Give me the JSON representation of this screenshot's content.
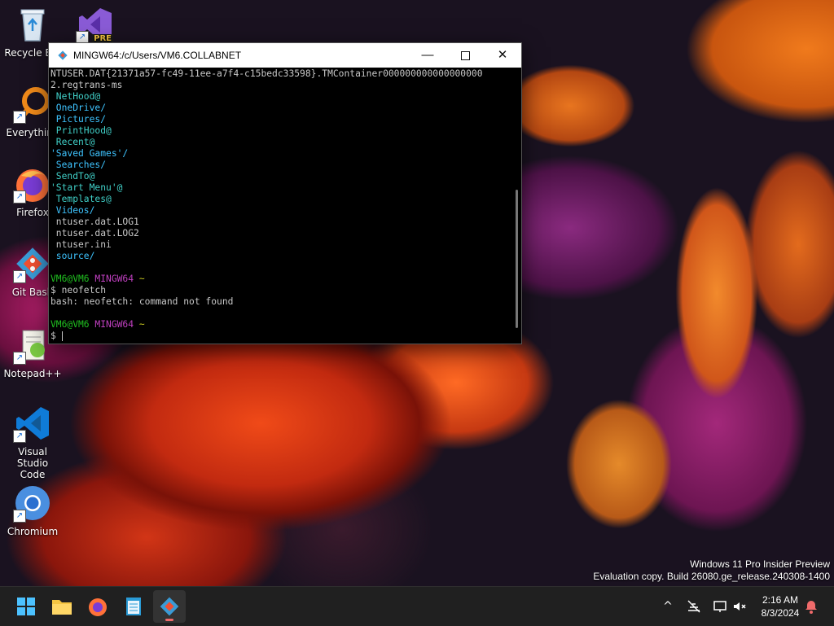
{
  "desktop": {
    "icons": [
      {
        "label": "Recycle Bin"
      },
      {
        "label": "",
        "badge": "PRE"
      },
      {
        "label": "Everything"
      },
      {
        "label": "Firefox"
      },
      {
        "label": "Git Bash"
      },
      {
        "label": "Notepad++"
      },
      {
        "label": "Visual Studio\nCode"
      },
      {
        "label": "Chromium"
      }
    ]
  },
  "terminal": {
    "title": "MINGW64:/c/Users/VM6.COLLABNET",
    "lines": [
      {
        "text": "NTUSER.DAT{21371a57-fc49-11ee-a7f4-c15bedc33598}.TMContainer000000000000000000",
        "cls": ""
      },
      {
        "text": "2.regtrans-ms",
        "cls": ""
      },
      {
        "text": " NetHood@",
        "cls": "c-link"
      },
      {
        "text": " OneDrive/",
        "cls": "c-dir"
      },
      {
        "text": " Pictures/",
        "cls": "c-dir"
      },
      {
        "text": " PrintHood@",
        "cls": "c-link"
      },
      {
        "text": " Recent@",
        "cls": "c-link"
      },
      {
        "text": "'Saved Games'/",
        "cls": "c-dir"
      },
      {
        "text": " Searches/",
        "cls": "c-dir"
      },
      {
        "text": " SendTo@",
        "cls": "c-link"
      },
      {
        "text": "'Start Menu'@",
        "cls": "c-link"
      },
      {
        "text": " Templates@",
        "cls": "c-link"
      },
      {
        "text": " Videos/",
        "cls": "c-dir"
      },
      {
        "text": " ntuser.dat.LOG1",
        "cls": ""
      },
      {
        "text": " ntuser.dat.LOG2",
        "cls": ""
      },
      {
        "text": " ntuser.ini",
        "cls": ""
      },
      {
        "text": " source/",
        "cls": "c-dir"
      },
      {
        "text": "",
        "cls": ""
      },
      {
        "prompt": true,
        "user": "VM6@VM6",
        "shell": "MINGW64",
        "path": "~"
      },
      {
        "text": "$ neofetch",
        "cls": ""
      },
      {
        "text": "bash: neofetch: command not found",
        "cls": ""
      },
      {
        "text": "",
        "cls": ""
      },
      {
        "prompt": true,
        "user": "VM6@VM6",
        "shell": "MINGW64",
        "path": "~"
      },
      {
        "text": "$ ",
        "cls": "",
        "cursor": true
      }
    ]
  },
  "watermark": {
    "line1": "Windows 11 Pro Insider Preview",
    "line2": "Evaluation copy. Build 26080.ge_release.240308-1400"
  },
  "taskbar": {
    "clock_time": "2:16 AM",
    "clock_date": "8/3/2024",
    "tray_chevron": "^"
  },
  "colors": {
    "accent": "#f06a6a",
    "dir": "#3ec4ff",
    "link": "#40d0c8",
    "prompt_user": "#20c020",
    "prompt_shell": "#c040c0",
    "prompt_path": "#c8c820"
  }
}
